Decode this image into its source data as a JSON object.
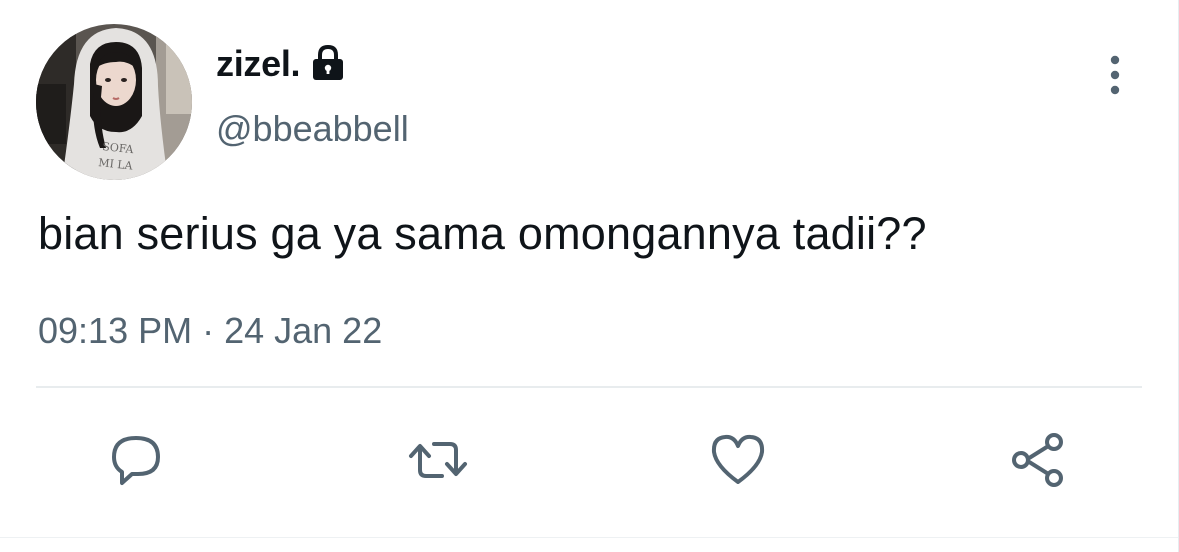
{
  "user": {
    "display_name": "zizel.",
    "handle": "@bbeabbell",
    "protected_icon": "lock-icon",
    "avatar": "profile-photo"
  },
  "tweet": {
    "text": "bian serius ga ya sama omongannya tadii??",
    "timestamp": "09:13 PM · 24 Jan 22"
  },
  "actions": [
    {
      "name": "reply",
      "icon": "speech-bubble-icon"
    },
    {
      "name": "retweet",
      "icon": "retweet-icon"
    },
    {
      "name": "like",
      "icon": "heart-icon"
    },
    {
      "name": "share",
      "icon": "share-icon"
    }
  ],
  "menu_icon": "more-vertical-icon",
  "colors": {
    "text_primary": "#0f1419",
    "text_secondary": "#536471",
    "divider": "#e8ecee",
    "icon": "#536471"
  }
}
